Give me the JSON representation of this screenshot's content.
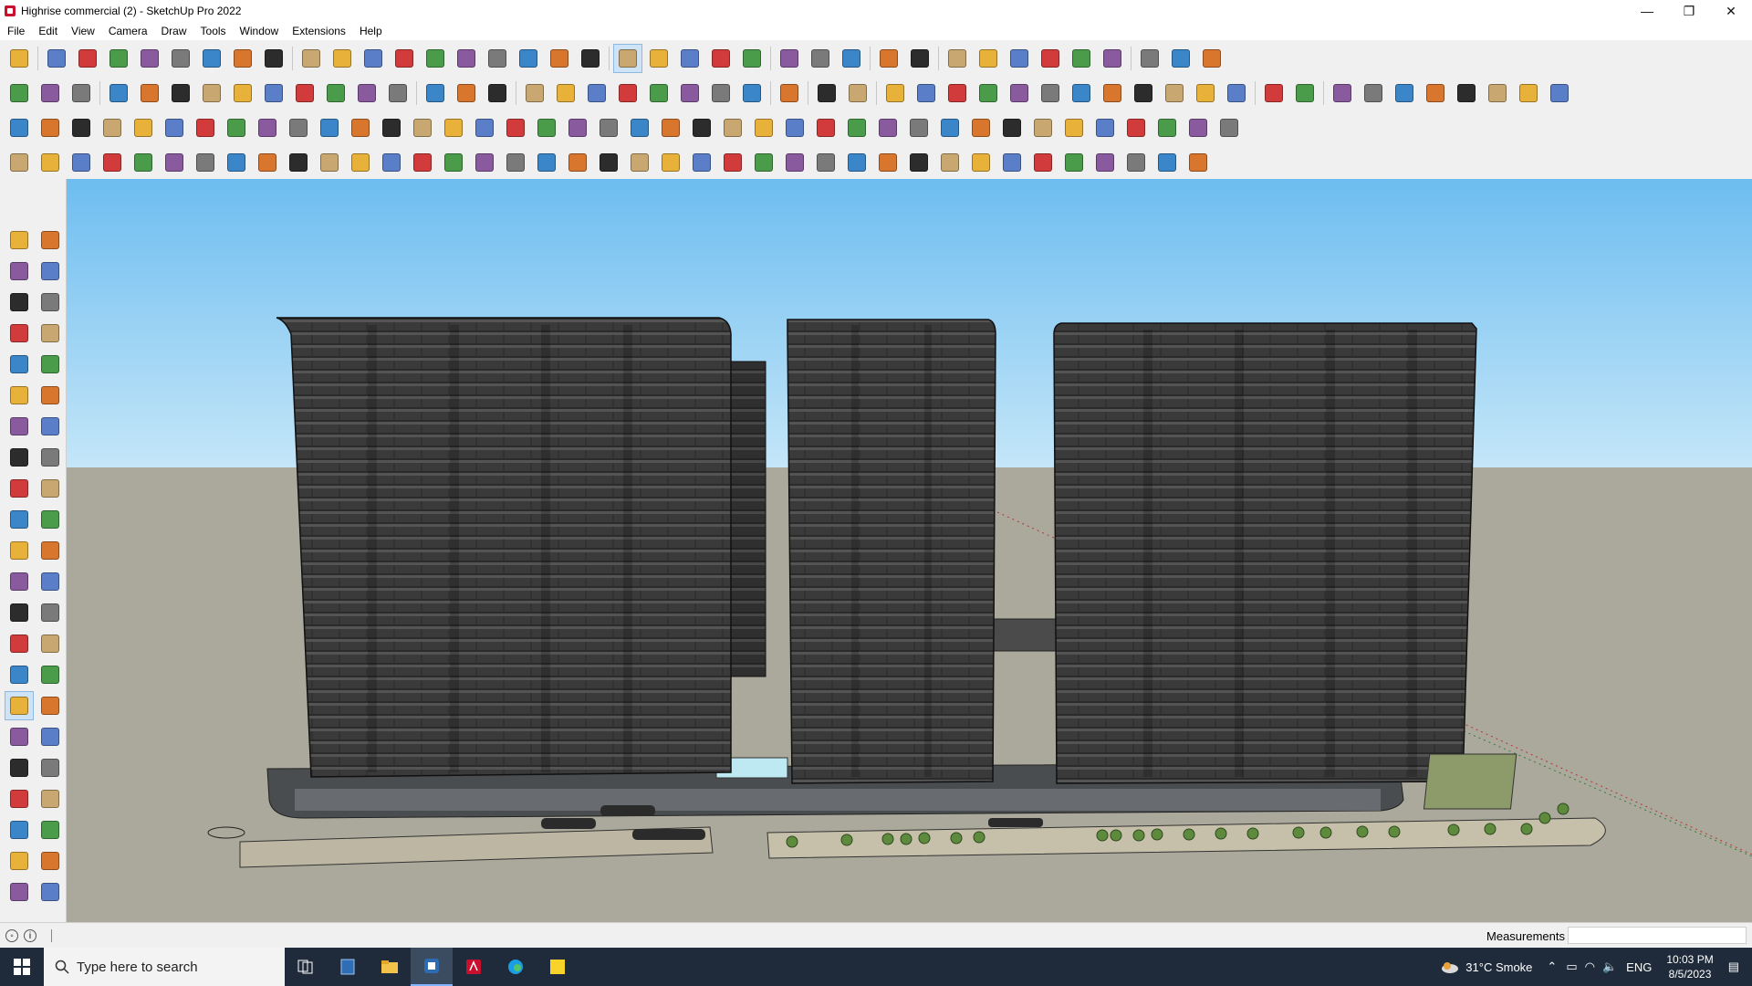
{
  "window": {
    "title": "Highrise commercial (2) - SketchUp Pro 2022",
    "minimize": "—",
    "maximize": "❐",
    "close": "✕"
  },
  "menu": [
    "File",
    "Edit",
    "View",
    "Camera",
    "Draw",
    "Tools",
    "Window",
    "Extensions",
    "Help"
  ],
  "toolbar_colors": [
    "#e8b13a",
    "#5a7fc8",
    "#d23b3b",
    "#4a9b4a",
    "#8a5a9e",
    "#7a7a7a",
    "#3a86c8",
    "#d8762e",
    "#2c2c2c",
    "#c8a870"
  ],
  "status": {
    "measurements_label": "Measurements",
    "measurements_value": ""
  },
  "taskbar": {
    "search_placeholder": "Type here to search",
    "weather": "31°C  Smoke",
    "language": "ENG",
    "time": "10:03 PM",
    "date": "8/5/2023"
  }
}
